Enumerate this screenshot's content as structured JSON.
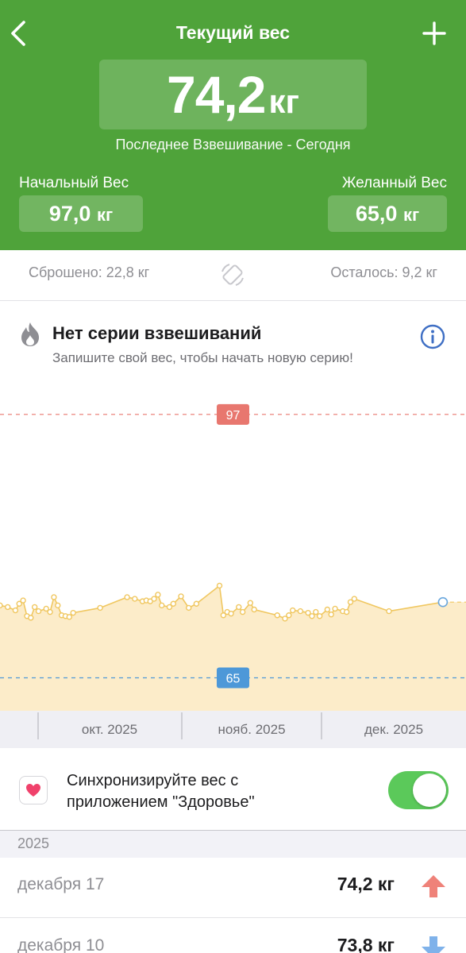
{
  "header": {
    "title": "Текущий вес",
    "current_value": "74,2",
    "unit": "кг",
    "last_weighing": "Последнее Взвешивание - Сегодня",
    "start_label": "Начальный Вес",
    "start_value": "97,0",
    "goal_label": "Желанный Вес",
    "goal_value": "65,0",
    "back_icon": "chevron-left-icon",
    "add_icon": "plus-icon"
  },
  "stats": {
    "lost": "Сброшено: 22,8 кг",
    "remaining": "Осталось: 9,2 кг"
  },
  "streak": {
    "title": "Нет серии взвешиваний",
    "subtitle": "Запишите свой вес, чтобы начать новую серию!"
  },
  "chart_data": {
    "type": "line",
    "start_line": {
      "label": "97",
      "value": 97,
      "color": "#e8776f"
    },
    "goal_line": {
      "label": "65",
      "value": 65,
      "color": "#4d98d8"
    },
    "ylim": [
      61,
      102
    ],
    "xlim": [
      "2025-08-24",
      "2025-12-23"
    ],
    "x_ticks": [
      "окт. 2025",
      "нояб. 2025",
      "дек. 2025"
    ],
    "x_tick_dates": [
      "2025-10-01",
      "2025-11-01",
      "2025-12-01"
    ],
    "line_color": "#f0c760",
    "area_color": "#fbe9bf",
    "series": [
      {
        "x": [
          "2025-08-24",
          "2025-08-26",
          "2025-08-28",
          "2025-08-29",
          "2025-08-30",
          "2025-08-31",
          "2025-09-01",
          "2025-09-02",
          "2025-09-03",
          "2025-09-05",
          "2025-09-06",
          "2025-09-07",
          "2025-09-08",
          "2025-09-09",
          "2025-09-10",
          "2025-09-11",
          "2025-09-12",
          "2025-09-19",
          "2025-09-26",
          "2025-09-28",
          "2025-09-30",
          "2025-10-01",
          "2025-10-02",
          "2025-10-03",
          "2025-10-04",
          "2025-10-05",
          "2025-10-07",
          "2025-10-08",
          "2025-10-10",
          "2025-10-12",
          "2025-10-14",
          "2025-10-20",
          "2025-10-21",
          "2025-10-22",
          "2025-10-23",
          "2025-10-25",
          "2025-10-26",
          "2025-10-28",
          "2025-10-29",
          "2025-11-04",
          "2025-11-06",
          "2025-11-07",
          "2025-11-08",
          "2025-11-10",
          "2025-11-12",
          "2025-11-13",
          "2025-11-14",
          "2025-11-15",
          "2025-11-17",
          "2025-11-18",
          "2025-11-19",
          "2025-11-21",
          "2025-11-22",
          "2025-11-23",
          "2025-11-24",
          "2025-12-03",
          "2025-12-17"
        ],
        "y": [
          73.8,
          73.6,
          73.2,
          74.0,
          74.4,
          72.5,
          72.3,
          73.6,
          73.1,
          73.4,
          73.0,
          74.8,
          73.8,
          72.6,
          72.5,
          72.4,
          72.9,
          73.5,
          74.8,
          74.6,
          74.3,
          74.4,
          74.3,
          74.6,
          75.1,
          73.8,
          73.6,
          74.0,
          74.9,
          73.5,
          74.0,
          76.2,
          72.6,
          73.0,
          72.8,
          73.6,
          73.0,
          74.1,
          73.3,
          72.6,
          72.2,
          72.6,
          73.2,
          73.1,
          72.9,
          72.5,
          73.0,
          72.5,
          73.3,
          72.7,
          73.4,
          73.1,
          73.0,
          74.2,
          74.6,
          73.1,
          74.2
        ]
      }
    ]
  },
  "sync": {
    "text_line1": "Синхронизируйте вес с",
    "text_line2": "приложением \"Здоровье\"",
    "toggle_on": true
  },
  "history": {
    "year": "2025",
    "rows": [
      {
        "date": "декабря 17",
        "weight": "74,2 кг",
        "trend": "up",
        "trend_icon": "arrow-up-icon",
        "color": "#ef8279"
      },
      {
        "date": "декабря 10",
        "weight": "73,8 кг",
        "trend": "down",
        "trend_icon": "arrow-down-icon",
        "color": "#7fb2ea"
      }
    ]
  }
}
